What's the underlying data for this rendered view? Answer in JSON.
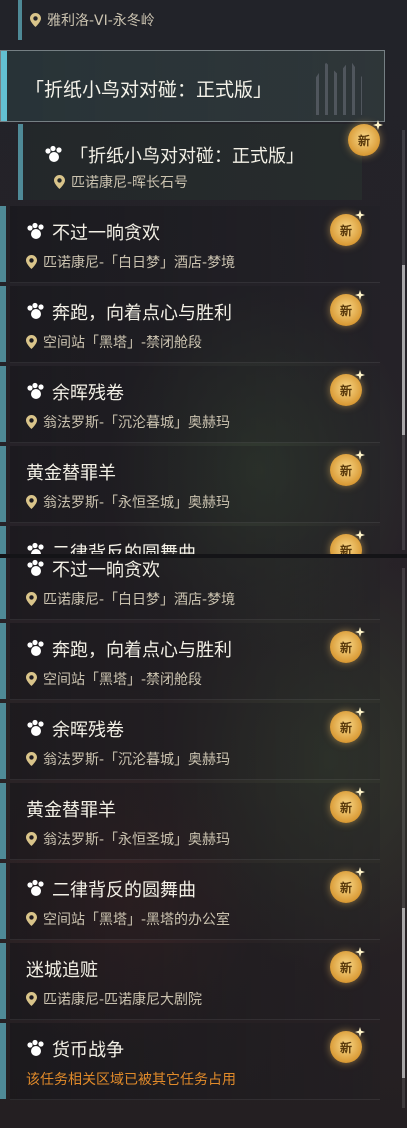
{
  "top_location": "雅利洛-VI-永冬岭",
  "selected": {
    "title": "「折纸小鸟对对碰：正式版」"
  },
  "expanded": {
    "title": "「折纸小鸟对对碰：正式版」",
    "location": "匹诺康尼-晖长石号",
    "badge": "新"
  },
  "list_a": [
    {
      "title": "不过一晌贪欢",
      "location": "匹诺康尼-「白日梦」酒店-梦境",
      "paw": true,
      "badge": "新"
    },
    {
      "title": "奔跑，向着点心与胜利",
      "location": "空间站「黑塔」-禁闭舱段",
      "paw": true,
      "badge": "新"
    },
    {
      "title": "余晖残卷",
      "location": "翁法罗斯-「沉沦暮城」奥赫玛",
      "paw": true,
      "badge": "新"
    },
    {
      "title": "黄金替罪羊",
      "location": "翁法罗斯-「永恒圣城」奥赫玛",
      "paw": false,
      "badge": "新"
    },
    {
      "title": "二律背反的圆舞曲",
      "location": "",
      "paw": true,
      "badge": "新"
    }
  ],
  "list_b": [
    {
      "title": "不过一晌贪欢",
      "location": "匹诺康尼-「白日梦」酒店-梦境",
      "paw": true,
      "badge": ""
    },
    {
      "title": "奔跑，向着点心与胜利",
      "location": "空间站「黑塔」-禁闭舱段",
      "paw": true,
      "badge": "新"
    },
    {
      "title": "余晖残卷",
      "location": "翁法罗斯-「沉沦暮城」奥赫玛",
      "paw": true,
      "badge": "新"
    },
    {
      "title": "黄金替罪羊",
      "location": "翁法罗斯-「永恒圣城」奥赫玛",
      "paw": false,
      "badge": "新"
    },
    {
      "title": "二律背反的圆舞曲",
      "location": "空间站「黑塔」-黑塔的办公室",
      "paw": true,
      "badge": "新"
    },
    {
      "title": "迷城追赃",
      "location": "匹诺康尼-匹诺康尼大剧院",
      "paw": false,
      "badge": "新"
    },
    {
      "title": "货币战争",
      "location": "",
      "warning": "该任务相关区域已被其它任务占用",
      "paw": true,
      "badge": "新"
    }
  ],
  "colors": {
    "accent_bar": "#4f8a97",
    "selected_accent": "#63c0d2",
    "warning": "#e08a2a",
    "badge": "#e3a846"
  }
}
